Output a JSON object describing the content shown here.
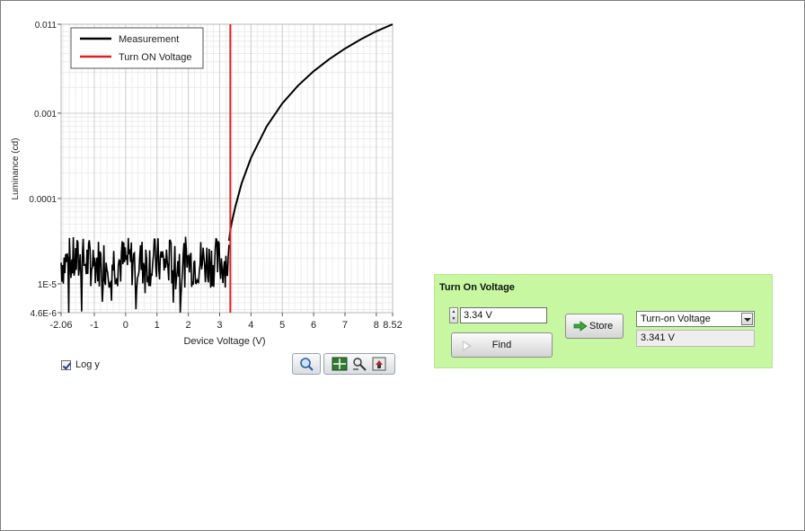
{
  "chart_data": {
    "type": "line",
    "xlabel": "Device Voltage (V)",
    "ylabel": "Luminance (cd)",
    "xlim": [
      -2.06,
      8.52
    ],
    "ylim": [
      4.6e-06,
      0.011
    ],
    "log_y": true,
    "x_ticks": [
      -2.06,
      -1,
      0,
      1,
      2,
      3,
      4,
      5,
      6,
      7,
      8,
      8.52
    ],
    "x_tick_labels": [
      "-2.06",
      "-1",
      "0",
      "1",
      "2",
      "3",
      "4",
      "5",
      "6",
      "7",
      "8",
      "8.52"
    ],
    "y_ticks": [
      4.6e-06,
      1e-05,
      0.0001,
      0.001,
      0.011
    ],
    "y_tick_labels": [
      "4.6E-6",
      "1E-5",
      "0.0001",
      "0.001",
      "0.011"
    ],
    "grid": true,
    "legend_position": "top-left",
    "series": [
      {
        "name": "Measurement",
        "color": "#000000",
        "noise_region": {
          "x_start": -2.06,
          "x_end": 3.3,
          "y_center": 1.8e-05,
          "y_spread_decades": 0.3
        },
        "x": [
          3.3,
          3.35,
          3.4,
          3.5,
          3.7,
          4.0,
          4.5,
          5.0,
          5.5,
          6.0,
          6.5,
          7.0,
          7.5,
          8.0,
          8.52
        ],
        "y": [
          3.2e-05,
          4.5e-05,
          5.5e-05,
          8e-05,
          0.00015,
          0.0003,
          0.0007,
          0.0013,
          0.0021,
          0.0031,
          0.0043,
          0.0057,
          0.0073,
          0.0091,
          0.011
        ]
      },
      {
        "name": "Turn ON Voltage",
        "color": "#e02020",
        "vertical_x": 3.341
      }
    ]
  },
  "graph": {
    "log_y_label": "Log y",
    "log_y_checked": true,
    "zoom_icon": "magnifier-icon",
    "cursor_icon": "cursor-crosshair-icon",
    "pan_icon": "pan-hand-icon",
    "zoom_area_icon": "zoom-area-icon"
  },
  "panel": {
    "title": "Turn On Voltage",
    "voltage_value": "3.34 V",
    "find_label": "Find",
    "store_label": "Store",
    "select_value": "Turn-on Voltage",
    "result_value": "3.341 V",
    "bg_color": "#c7f7a0"
  }
}
